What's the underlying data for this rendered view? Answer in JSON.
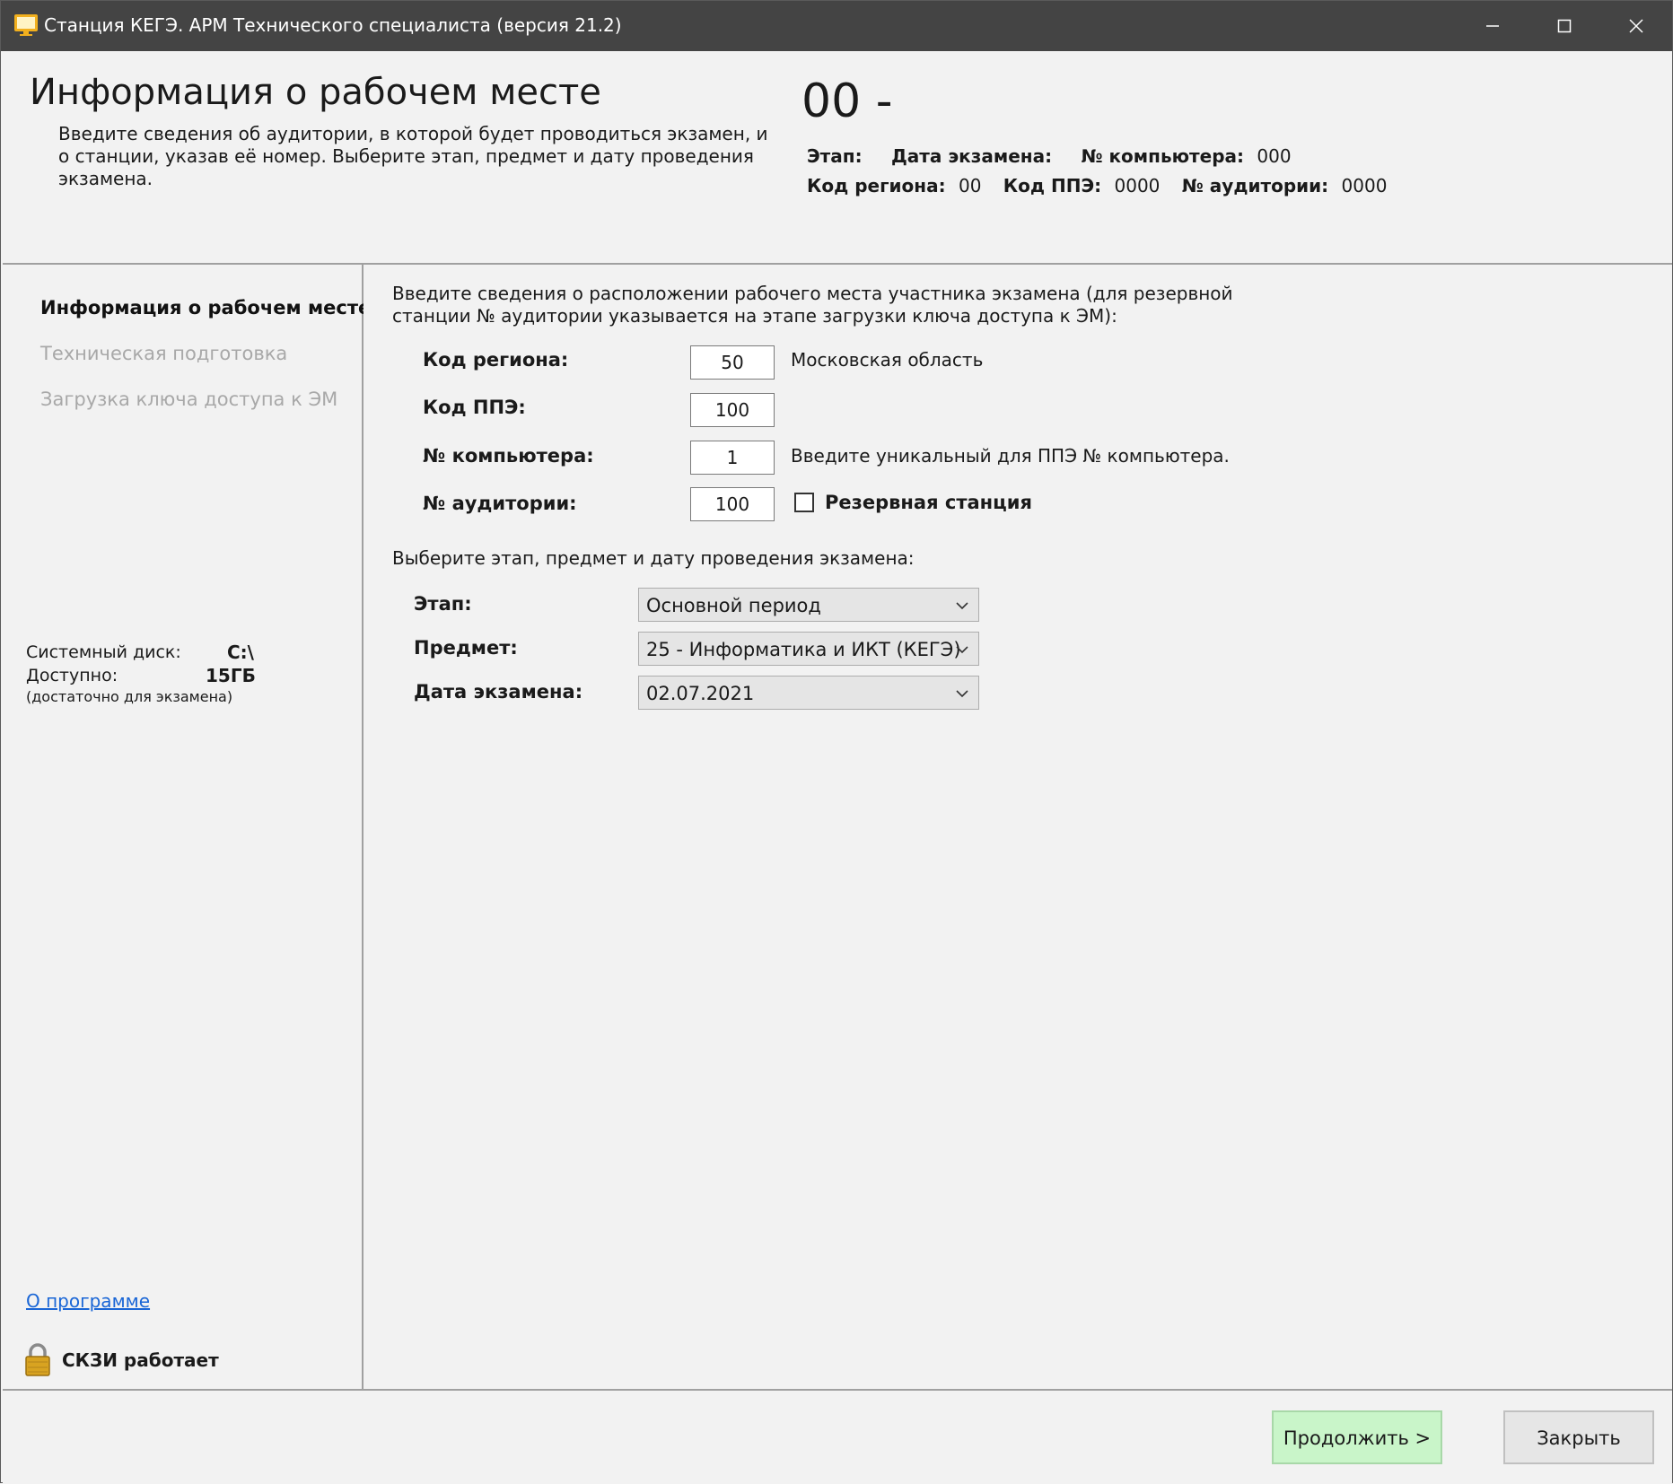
{
  "window": {
    "title": "Станция КЕГЭ. АРМ Технического специалиста (версия 21.2)"
  },
  "header": {
    "title": "Информация о рабочем месте",
    "description": "Введите сведения об аудитории, в которой будет проводиться экзамен, и о станции, указав её номер. Выберите этап, предмет и дату проведения экзамена.",
    "code": "00 -",
    "stage_label": "Этап:",
    "exam_date_label": "Дата экзамена:",
    "computer_label": "№ компьютера:",
    "computer_value": "000",
    "region_label": "Код региона:",
    "region_value": "00",
    "ppe_label": "Код ППЭ:",
    "ppe_value": "0000",
    "auditorium_label": "№ аудитории:",
    "auditorium_value": "0000"
  },
  "sidebar": {
    "items": [
      {
        "label": "Информация о рабочем месте",
        "state": "active"
      },
      {
        "label": "Техническая подготовка",
        "state": "disabled"
      },
      {
        "label": "Загрузка ключа доступа к ЭМ",
        "state": "disabled"
      }
    ],
    "disk_label": "Системный диск:",
    "disk_value": "C:\\",
    "available_label": "Доступно:",
    "available_value": "15ГБ",
    "sufficient_note": "(достаточно для экзамена)",
    "about_link": "О программе",
    "crypto_status": "СКЗИ работает"
  },
  "main": {
    "intro": "Введите сведения о расположении рабочего места участника экзамена (для резервной станции № аудитории указывается на этапе загрузки ключа доступа к ЭМ):",
    "fields": [
      {
        "label": "Код региона:",
        "value": "50",
        "note": "Московская область"
      },
      {
        "label": "Код ППЭ:",
        "value": "100",
        "note": ""
      },
      {
        "label": "№ компьютера:",
        "value": "1",
        "note": "Введите уникальный для ППЭ № компьютера."
      },
      {
        "label": "№ аудитории:",
        "value": "100",
        "note": ""
      }
    ],
    "reserve_checkbox_label": "Резервная станция",
    "reserve_checked": false,
    "select_intro": "Выберите этап, предмет и дату проведения экзамена:",
    "selects": [
      {
        "label": "Этап:",
        "value": "Основной период"
      },
      {
        "label": "Предмет:",
        "value": "25 - Информатика и ИКТ (КЕГЭ)"
      },
      {
        "label": "Дата экзамена:",
        "value": "02.07.2021"
      }
    ]
  },
  "footer": {
    "continue_button": "Продолжить >",
    "close_button": "Закрыть"
  },
  "colors": {
    "titlebar": "#444444",
    "continue_bg": "#c9f5c9",
    "link": "#1a66d6"
  }
}
